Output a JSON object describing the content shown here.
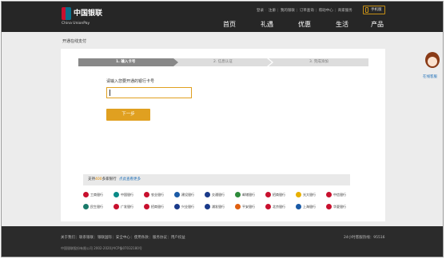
{
  "header": {
    "logo_cn": "中国银联",
    "logo_en": "China UnionPay",
    "top_links": [
      "登录",
      "注册",
      "我的银联",
      "订单查询",
      "帮助中心",
      "商家服务"
    ],
    "mobile_label": "手机版",
    "nav": [
      "首页",
      "礼遇",
      "优惠",
      "生活",
      "产品"
    ]
  },
  "page": {
    "title": "开通在线支付",
    "steps": [
      "1. 输入卡号",
      "2. 信息认证",
      "3. 完成添加"
    ],
    "card_label": "请输入您要开通的银行卡号",
    "card_value": "",
    "next_label": "下一步"
  },
  "banks": {
    "prefix": "支持",
    "count": "400",
    "suffix": "多家银行",
    "more_link": "点此查看更多",
    "items": [
      {
        "name": "工商银行",
        "color": "#c8102e"
      },
      {
        "name": "中国银行",
        "color": "#0a8a87"
      },
      {
        "name": "农业银行",
        "color": "#c8102e"
      },
      {
        "name": "建设银行",
        "color": "#1a5aa6"
      },
      {
        "name": "交通银行",
        "color": "#1a3a8a"
      },
      {
        "name": "邮储银行",
        "color": "#2e8b3a"
      },
      {
        "name": "招商银行",
        "color": "#c8102e"
      },
      {
        "name": "光大银行",
        "color": "#e8b000"
      },
      {
        "name": "中信银行",
        "color": "#c8102e"
      },
      {
        "name": "民生银行",
        "color": "#1a7a6a"
      },
      {
        "name": "广发银行",
        "color": "#c8102e"
      },
      {
        "name": "招商银行",
        "color": "#c8102e"
      },
      {
        "name": "兴业银行",
        "color": "#1a3a8a"
      },
      {
        "name": "浦发银行",
        "color": "#1a3a8a"
      },
      {
        "name": "平安银行",
        "color": "#e06010"
      },
      {
        "name": "北京银行",
        "color": "#c8102e"
      },
      {
        "name": "上海银行",
        "color": "#1a5aa6"
      },
      {
        "name": "华夏银行",
        "color": "#c8102e"
      }
    ]
  },
  "chat": {
    "label": "在线客服"
  },
  "footer": {
    "links": [
      "关于我们",
      "联系银联",
      "银联国际",
      "安全中心",
      "使用条款",
      "服务协议",
      "用户权益"
    ],
    "right": "24小时客服热线：95516",
    "copyright": "中国银联股份有限公司  2002-2020沪ICP备07032180号"
  }
}
